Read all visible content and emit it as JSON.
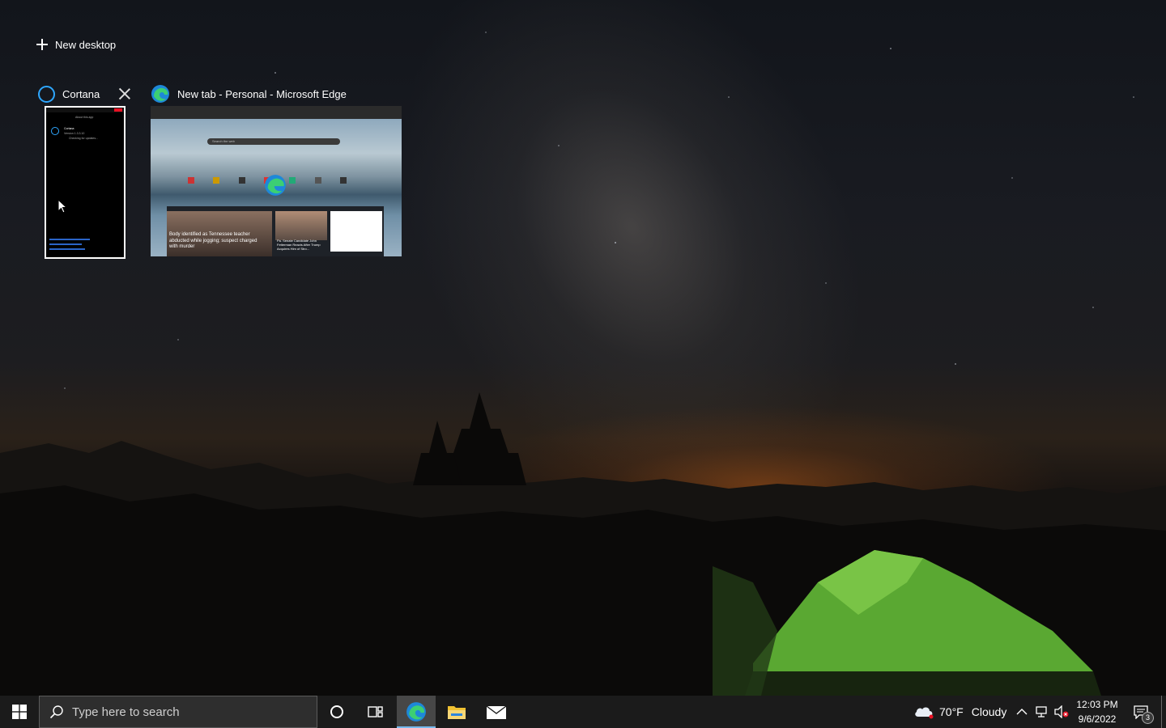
{
  "task_view": {
    "new_desktop_label": "New desktop",
    "windows": [
      {
        "title": "Cortana",
        "app_icon": "cortana-icon",
        "close_icon": "close-icon"
      },
      {
        "title": "New tab - Personal - Microsoft Edge",
        "app_icon": "edge-icon"
      }
    ],
    "cortana_thumb": {
      "header": "About this app",
      "app_name": "Cortana",
      "version": "Version 1.3.3.10",
      "status": "Checking for updates..."
    },
    "edge_thumb": {
      "search_placeholder": "Search the web",
      "headline_1": "Body identified as Tennessee teacher abducted while jogging; suspect charged with murder",
      "headline_2": "Pa. Senate Candidate John Fetterman Reacts After Trump Acquires Him of Stro..."
    }
  },
  "taskbar": {
    "search_placeholder": "Type here to search",
    "weather_temp": "70°F",
    "weather_desc": "Cloudy",
    "time": "12:03 PM",
    "date": "9/6/2022",
    "notification_count": "3",
    "colors": {
      "bar": "#1b1b1b",
      "accent": "#76b9ed",
      "cortana": "#2ea7ff"
    }
  }
}
